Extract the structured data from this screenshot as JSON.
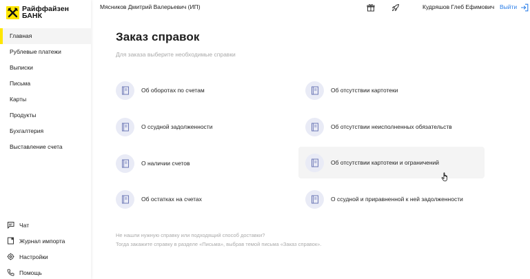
{
  "brand": {
    "line1": "Райффайзен",
    "line2": "БАНК",
    "color": "#FEE600"
  },
  "sidebar": {
    "items": [
      {
        "label": "Главная",
        "active": true
      },
      {
        "label": "Рублевые платежи"
      },
      {
        "label": "Выписки"
      },
      {
        "label": "Письма"
      },
      {
        "label": "Карты"
      },
      {
        "label": "Продукты"
      },
      {
        "label": "Бухгалтерия"
      },
      {
        "label": "Выставление счета"
      }
    ],
    "bottom": [
      {
        "label": "Чат",
        "icon": "chat-icon"
      },
      {
        "label": "Журнал импорта",
        "icon": "import-log-icon"
      },
      {
        "label": "Настройки",
        "icon": "settings-icon"
      },
      {
        "label": "Помощь",
        "icon": "help-phone-icon"
      }
    ]
  },
  "header": {
    "company": "Мясников Дмитрий Валерьевич (ИП)",
    "user": "Кудряшов Глеб Ефимович",
    "logout": "Выйти",
    "icons": [
      "gift-icon",
      "rocket-icon",
      "logout-icon"
    ],
    "accent": "#2a7ee8"
  },
  "main": {
    "title": "Заказ справок",
    "subtitle": "Для заказа выберите необходимые справки",
    "certificates": [
      {
        "label": "Об оборотах по счетам"
      },
      {
        "label": "Об отсутствии картотеки"
      },
      {
        "label": "О ссудной задолженности"
      },
      {
        "label": "Об отсутствии неисполненных обязательств"
      },
      {
        "label": "О наличии счетов"
      },
      {
        "label": "Об отсутствии картотеки и ограничений"
      },
      {
        "label": "Об остатках на счетах"
      },
      {
        "label": "О ссудной и приравненной к ней задолженности"
      }
    ],
    "icon": "document-icon",
    "note_line1": "Не нашли нужную справку или подходящий способ доставки?",
    "note_line2": "Тогда закажите справку в разделе «Письма», выбрав темой письма «Заказ справок»."
  }
}
